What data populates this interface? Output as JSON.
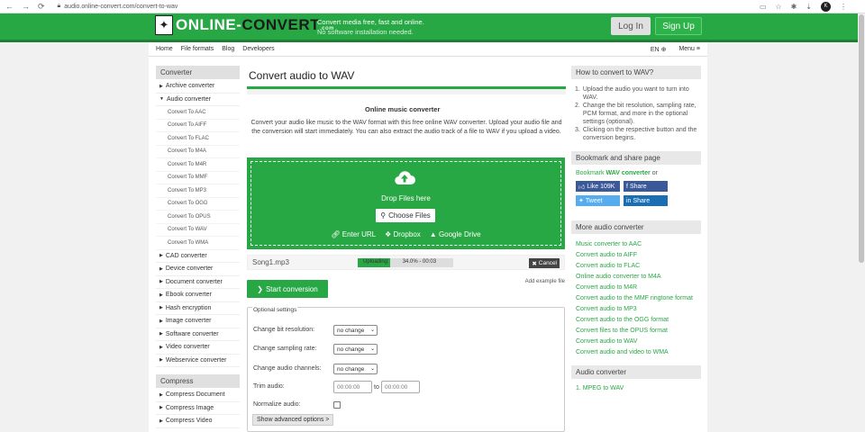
{
  "browser": {
    "url": "audio.online-convert.com/convert-to-wav",
    "profile_initial": "K"
  },
  "header": {
    "logo_text_a": "ONLINE-",
    "logo_text_b": "CONVERT",
    "logo_tld": ".com",
    "tagline_1": "Convert media free, fast and online.",
    "tagline_2": "No software installation needed.",
    "login": "Log In",
    "signup": "Sign Up",
    "brand_color": "#28a745"
  },
  "menu": {
    "items": [
      "Home",
      "File formats",
      "Blog",
      "Developers"
    ],
    "lang": "EN",
    "menu_label": "Menu"
  },
  "sidebar": {
    "converter_title": "Converter",
    "items_before": [
      "Archive converter"
    ],
    "audio_title": "Audio converter",
    "audio_sub": [
      "Convert To AAC",
      "Convert To AIFF",
      "Convert To FLAC",
      "Convert To M4A",
      "Convert To M4R",
      "Convert To MMF",
      "Convert To MP3",
      "Convert To OGG",
      "Convert To OPUS",
      "Convert To WAV",
      "Convert To WMA"
    ],
    "items_after": [
      "CAD converter",
      "Device converter",
      "Document converter",
      "Ebook converter",
      "Hash encryption",
      "Image converter",
      "Software converter",
      "Video converter",
      "Webservice converter"
    ],
    "compress_title": "Compress",
    "compress_items": [
      "Compress Document",
      "Compress Image",
      "Compress Video"
    ]
  },
  "main": {
    "title": "Convert audio to WAV",
    "subtitle": "Online music converter",
    "description": "Convert your audio like music to the WAV format with this free online WAV converter. Upload your audio file and the conversion will start immediately. You can also extract the audio track of a file to WAV if you upload a video.",
    "drop_text": "Drop Files here",
    "choose_files": "Choose Files",
    "sources": [
      "Enter URL",
      "Dropbox",
      "Google Drive"
    ],
    "file": {
      "name": "Song1.mp3",
      "status": "Uploading:",
      "progress_text": "34.0% - 00:03",
      "progress_fraction": 0.34,
      "cancel": "Cancel"
    },
    "start_conversion": "Start conversion",
    "add_example": "Add example file",
    "options": {
      "legend": "Optional settings",
      "bit_resolution_label": "Change bit resolution:",
      "bit_resolution_value": "no change",
      "sampling_label": "Change sampling rate:",
      "sampling_value": "no change",
      "channels_label": "Change audio channels:",
      "channels_value": "no change",
      "trim_label": "Trim audio:",
      "trim_from": "00:00:00",
      "trim_to_word": "to",
      "trim_to": "00:00:00",
      "normalize_label": "Normalize audio:",
      "advanced_button": "Show advanced options >"
    }
  },
  "right": {
    "howto_title": "How to convert to WAV?",
    "howto_steps": [
      "Upload the audio you want to turn into WAV.",
      "Change the bit resolution, sampling rate, PCM format, and more in the optional settings (optional).",
      "Clicking on the respective button and the conversion begins."
    ],
    "bookmark_title": "Bookmark and share page",
    "bookmark_prefix": "Bookmark",
    "bookmark_link": "WAV converter",
    "bookmark_suffix": "or",
    "share": [
      "Like 109K",
      "Share",
      "Tweet",
      "Share"
    ],
    "more_title": "More audio converter",
    "more_links": [
      "Music converter to AAC",
      "Convert audio to AIFF",
      "Convert audio to FLAC",
      "Online audio converter to M4A",
      "Convert audio to M4R",
      "Convert audio to the MMF ringtone format",
      "Convert audio to MP3",
      "Convert audio to the OGG format",
      "Convert files to the OPUS format",
      "Convert audio to WAV",
      "Convert audio and video to WMA"
    ],
    "audio_converter_title": "Audio converter",
    "audio_converter_first": "1. MPEG to WAV"
  }
}
